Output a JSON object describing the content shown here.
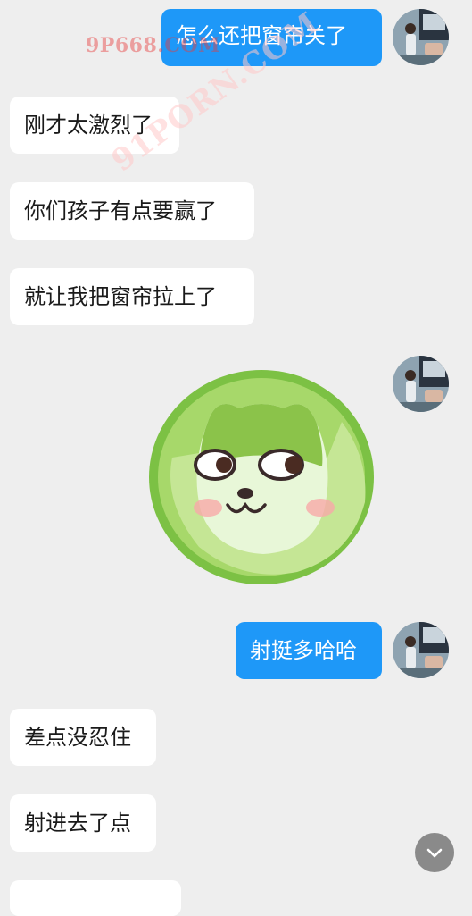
{
  "messages": [
    {
      "side": "out",
      "text": "怎么还把窗帘关了"
    },
    {
      "side": "in",
      "text": "刚才太激烈了"
    },
    {
      "side": "in",
      "text": "你们孩子有点要赢了"
    },
    {
      "side": "in",
      "text": "就让我把窗帘拉上了"
    },
    {
      "side": "out",
      "type": "sticker",
      "sticker": "cabbage-dog-sticker"
    },
    {
      "side": "out",
      "text": "射挺多哈哈"
    },
    {
      "side": "in",
      "text": "差点没忍住"
    },
    {
      "side": "in",
      "text": "射进去了点"
    }
  ],
  "watermarks": {
    "top": "9P668.COM",
    "diagonal": "91PORN.COM"
  },
  "icons": {
    "scroll_down": "chevron-down-icon"
  },
  "colors": {
    "background": "#eeeeee",
    "outgoing_bubble": "#1e98f8",
    "incoming_bubble": "#ffffff"
  }
}
